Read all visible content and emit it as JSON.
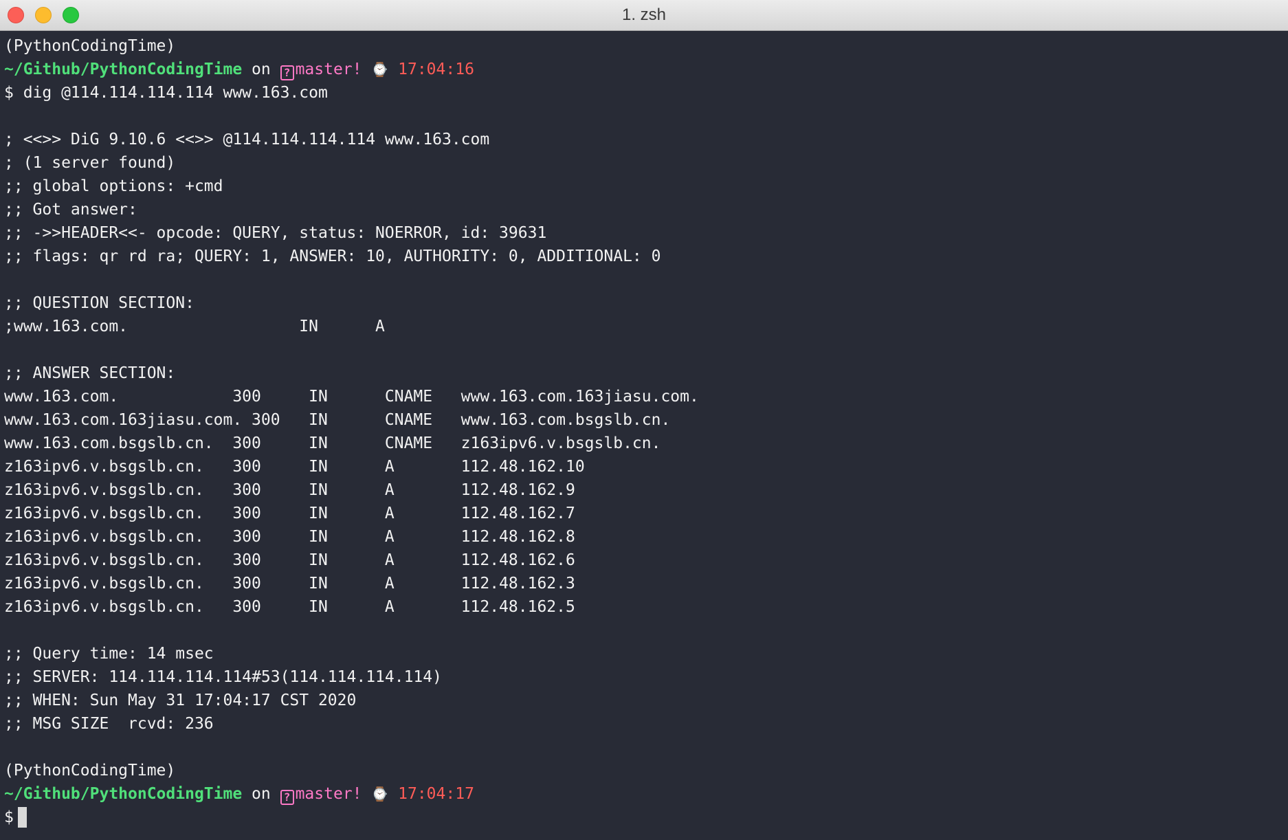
{
  "window": {
    "title": "1. zsh"
  },
  "prompt1": {
    "env": "(PythonCodingTime)",
    "path": "~/Github/PythonCodingTime",
    "on": " on ",
    "branch_icon": "?",
    "branch": "master!",
    "clock_icon": "⌚",
    "time": "17:04:16",
    "command": "$ dig @114.114.114.114 www.163.com"
  },
  "output": [
    "",
    "; <<>> DiG 9.10.6 <<>> @114.114.114.114 www.163.com",
    "; (1 server found)",
    ";; global options: +cmd",
    ";; Got answer:",
    ";; ->>HEADER<<- opcode: QUERY, status: NOERROR, id: 39631",
    ";; flags: qr rd ra; QUERY: 1, ANSWER: 10, AUTHORITY: 0, ADDITIONAL: 0",
    "",
    ";; QUESTION SECTION:",
    ";www.163.com.                  IN      A",
    "",
    ";; ANSWER SECTION:",
    "www.163.com.            300     IN      CNAME   www.163.com.163jiasu.com.",
    "www.163.com.163jiasu.com. 300   IN      CNAME   www.163.com.bsgslb.cn.",
    "www.163.com.bsgslb.cn.  300     IN      CNAME   z163ipv6.v.bsgslb.cn.",
    "z163ipv6.v.bsgslb.cn.   300     IN      A       112.48.162.10",
    "z163ipv6.v.bsgslb.cn.   300     IN      A       112.48.162.9",
    "z163ipv6.v.bsgslb.cn.   300     IN      A       112.48.162.7",
    "z163ipv6.v.bsgslb.cn.   300     IN      A       112.48.162.8",
    "z163ipv6.v.bsgslb.cn.   300     IN      A       112.48.162.6",
    "z163ipv6.v.bsgslb.cn.   300     IN      A       112.48.162.3",
    "z163ipv6.v.bsgslb.cn.   300     IN      A       112.48.162.5",
    "",
    ";; Query time: 14 msec",
    ";; SERVER: 114.114.114.114#53(114.114.114.114)",
    ";; WHEN: Sun May 31 17:04:17 CST 2020",
    ";; MSG SIZE  rcvd: 236",
    ""
  ],
  "prompt2": {
    "env": "(PythonCodingTime)",
    "path": "~/Github/PythonCodingTime",
    "on": " on ",
    "branch_icon": "?",
    "branch": "master!",
    "clock_icon": "⌚",
    "time": "17:04:17",
    "command": "$"
  },
  "colors": {
    "background": "#282b36",
    "path": "#50e07a",
    "branch": "#ff79c6",
    "time": "#ff5c57",
    "text": "#f2f2f2"
  }
}
